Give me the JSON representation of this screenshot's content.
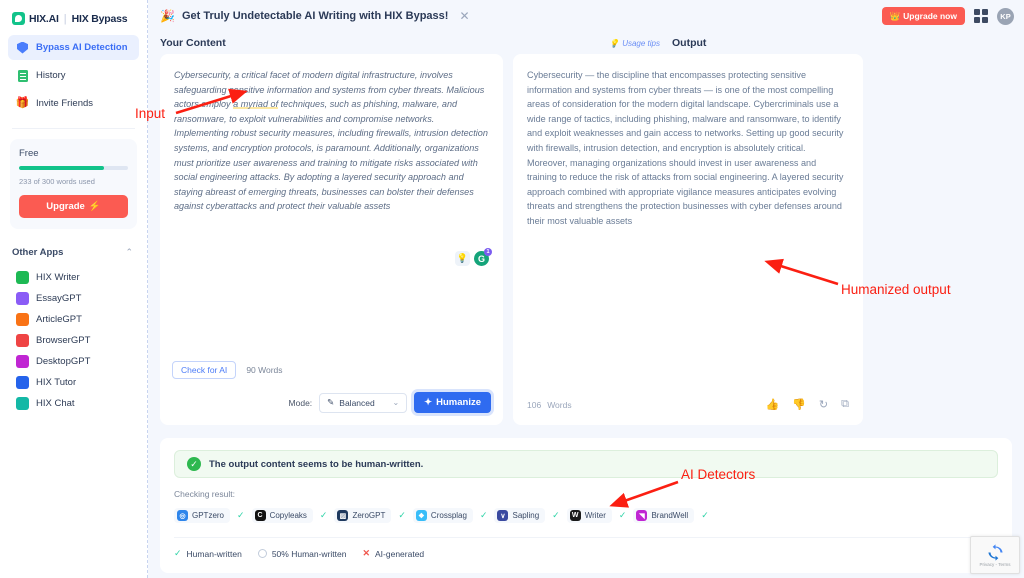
{
  "sidebar": {
    "brand": {
      "name": "HIX.AI",
      "separator": "|",
      "sub": "HIX Bypass",
      "logo_icon": "hix-logo-icon"
    },
    "nav": [
      {
        "label": "Bypass AI Detection",
        "icon": "shield-icon",
        "active": true
      },
      {
        "label": "History",
        "icon": "document-icon",
        "active": false
      },
      {
        "label": "Invite Friends",
        "icon": "gift-icon",
        "active": false
      }
    ],
    "plan": {
      "title": "Free",
      "progress_percent": 78,
      "usage_text": "233 of 300 words used",
      "upgrade_label": "Upgrade",
      "upgrade_icon": "bolt-icon"
    },
    "other_apps": {
      "title": "Other Apps",
      "collapse_icon": "chevron-up-icon",
      "items": [
        {
          "label": "HIX Writer",
          "color": "#1db954",
          "glyph": "✎"
        },
        {
          "label": "EssayGPT",
          "color": "#8a5cf6",
          "glyph": "▣"
        },
        {
          "label": "ArticleGPT",
          "color": "#f97316",
          "glyph": "☷"
        },
        {
          "label": "BrowserGPT",
          "color": "#ef4444",
          "glyph": "✳"
        },
        {
          "label": "DesktopGPT",
          "color": "#c026d3",
          "glyph": "▦"
        },
        {
          "label": "HIX Tutor",
          "color": "#2563eb",
          "glyph": "◕"
        },
        {
          "label": "HIX Chat",
          "color": "#14b8a6",
          "glyph": "●"
        }
      ]
    }
  },
  "topbar": {
    "promo_icon": "confetti-icon",
    "promo_text": "Get Truly Undetectable AI Writing with HIX Bypass!",
    "close_icon": "close-icon",
    "upgrade_now_label": "Upgrade now",
    "upgrade_now_icon": "crown-icon",
    "apps_grid_icon": "apps-grid-icon",
    "avatar_initials": "KP"
  },
  "columns": {
    "left_title": "Your Content",
    "usage_tips_label": "Usage tips",
    "usage_tips_icon": "lightbulb-icon",
    "right_title": "Output"
  },
  "input_panel": {
    "text_before_highlight": "Cybersecurity, a critical facet of modern digital infrastructure, involves safeguarding sensitive information and systems from cyber threats. Malicious actors employ ",
    "highlighted_text": "a myriad of",
    "text_after_highlight": " techniques, such as phishing, malware, and ransomware, to exploit vulnerabilities and compromise networks. Implementing robust security measures, including firewalls, intrusion detection systems, and encryption protocols, is paramount. Additionally, organizations must prioritize user awareness and training to mitigate risks associated with social engineering attacks. By adopting a layered security approach and staying abreast of emerging threats, businesses can bolster their defenses against cyberattacks and protect their valuable assets",
    "assist_bulb_icon": "lightbulb-icon",
    "grammarly_icon": "grammarly-icon",
    "grammarly_count": "1",
    "check_for_ai_label": "Check for AI",
    "word_count": "90 Words",
    "mode_label": "Mode:",
    "mode_value": "Balanced",
    "mode_icon": "pen-icon",
    "mode_chevron_icon": "chevron-down-icon",
    "humanize_label": "Humanize",
    "humanize_icon": "sparkle-icon"
  },
  "output_panel": {
    "text": "Cybersecurity — the discipline that encompasses protecting sensitive information and systems from cyber threats — is one of the most compelling areas of consideration for the modern digital landscape. Cybercriminals use a wide range of tactics, including phishing, malware and ransomware, to identify and exploit weaknesses and gain access to networks. Setting up good security with firewalls, intrusion detection, and encryption is absolutely critical. Moreover, managing organizations should invest in user awareness and training to reduce the risk of attacks from social engineering. A layered security approach combined with appropriate vigilance measures anticipates evolving threats and strengthens the protection businesses with cyber defenses around their most valuable assets",
    "word_number": "106",
    "word_label": "Words",
    "actions": [
      {
        "icon": "thumbs-up-icon",
        "glyph": "👍"
      },
      {
        "icon": "thumbs-down-icon",
        "glyph": "👎"
      },
      {
        "icon": "refresh-icon",
        "glyph": "↻"
      },
      {
        "icon": "copy-icon",
        "glyph": "⧉"
      }
    ]
  },
  "detector_panel": {
    "alert_icon": "check-circle-icon",
    "alert_text": "The output content seems to be human-written.",
    "checking_label": "Checking result:",
    "detectors": [
      {
        "name": "GPTzero",
        "color": "#2f86eb",
        "glyph": "◎",
        "status_icon": "check-icon"
      },
      {
        "name": "Copyleaks",
        "color": "#121212",
        "glyph": "C",
        "status_icon": "check-icon"
      },
      {
        "name": "ZeroGPT",
        "color": "#1f3a5f",
        "glyph": "▨",
        "status_icon": "check-icon"
      },
      {
        "name": "Crossplag",
        "color": "#38bdf8",
        "glyph": "❖",
        "status_icon": "check-icon"
      },
      {
        "name": "Sapling",
        "color": "#3b4aa0",
        "glyph": "∨",
        "status_icon": "check-icon"
      },
      {
        "name": "Writer",
        "color": "#1a1a1a",
        "glyph": "W",
        "status_icon": "check-icon"
      },
      {
        "name": "BrandWell",
        "color": "#c026d3",
        "glyph": "◥",
        "status_icon": "check-icon"
      }
    ],
    "legend": [
      {
        "label": "Human-written",
        "marker": "check-icon"
      },
      {
        "label": "50% Human-written",
        "marker": "half-circle-icon"
      },
      {
        "label": "AI-generated",
        "marker": "cross-icon"
      }
    ]
  },
  "annotations": {
    "input_label": "Input",
    "output_label": "Humanized output",
    "detectors_label": "AI Detectors",
    "color": "#fb1f12"
  },
  "recaptcha": {
    "text": "Privacy - Terms",
    "icon": "recaptcha-icon"
  }
}
